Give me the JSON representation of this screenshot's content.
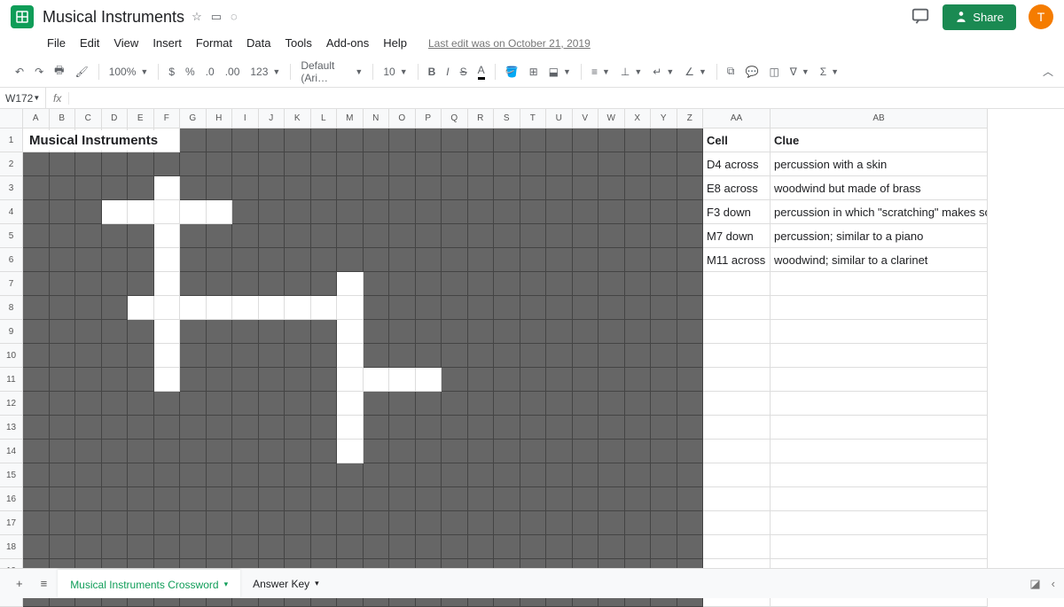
{
  "doc": {
    "title": "Musical Instruments",
    "last_edit": "Last edit was on October 21, 2019"
  },
  "share": {
    "label": "Share"
  },
  "avatar": {
    "letter": "T"
  },
  "menus": [
    "File",
    "Edit",
    "View",
    "Insert",
    "Format",
    "Data",
    "Tools",
    "Add-ons",
    "Help"
  ],
  "toolbar": {
    "zoom": "100%",
    "font": "Default (Ari…",
    "size": "10"
  },
  "namebox": "W172",
  "cols_narrow": [
    "A",
    "B",
    "C",
    "D",
    "E",
    "F",
    "G",
    "H",
    "I",
    "J",
    "K",
    "L",
    "M",
    "N",
    "O",
    "P",
    "Q",
    "R",
    "S",
    "T",
    "U",
    "V",
    "W",
    "X",
    "Y",
    "Z"
  ],
  "col_aa": "AA",
  "col_ab": "AB",
  "rows": 20,
  "title_text": "Musical Instruments",
  "white_cells": {
    "3": [
      6
    ],
    "4": [
      4,
      5,
      6,
      7,
      8
    ],
    "5": [
      6
    ],
    "6": [
      6
    ],
    "7": [
      6,
      13
    ],
    "8": [
      5,
      6,
      7,
      8,
      9,
      10,
      11,
      12,
      13
    ],
    "9": [
      6,
      13
    ],
    "10": [
      6,
      13
    ],
    "11": [
      6,
      13,
      14,
      15,
      16
    ],
    "12": [
      13
    ],
    "13": [
      13
    ],
    "14": [
      13
    ]
  },
  "clues_header": {
    "cell": "Cell",
    "clue": "Clue"
  },
  "clues": [
    {
      "cell": "D4 across",
      "clue": "percussion with a skin"
    },
    {
      "cell": "E8 across",
      "clue": "woodwind but made of brass"
    },
    {
      "cell": "F3 down",
      "clue": "percussion in which \"scratching\" makes sounds"
    },
    {
      "cell": "M7 down",
      "clue": "percussion; similar to a piano"
    },
    {
      "cell": "M11 across",
      "clue": "woodwind; similar to a clarinet"
    }
  ],
  "tabs": [
    {
      "name": "Musical Instruments Crossword",
      "active": true
    },
    {
      "name": "Answer Key",
      "active": false
    }
  ]
}
